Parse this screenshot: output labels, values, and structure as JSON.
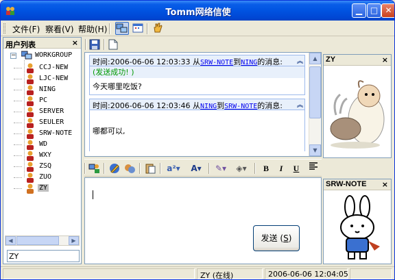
{
  "window": {
    "title": "Tomm网络信使"
  },
  "menu": {
    "items": [
      {
        "label": "文件(F)"
      },
      {
        "label": "察看(V)"
      },
      {
        "label": "帮助(H)"
      }
    ]
  },
  "user_panel": {
    "title": "用户列表",
    "close": "×",
    "root": "WORKGROUP",
    "users": [
      "CCJ-NEW",
      "LJC-NEW",
      "NING",
      "PC",
      "SERVER",
      "SEULER",
      "SRW-NOTE",
      "WD",
      "WXY",
      "ZSQ",
      "ZUO",
      "ZY"
    ],
    "selected_user": "ZY",
    "search_value": "ZY"
  },
  "messages": [
    {
      "time_prefix": "时间:2006-06-06 12:03:33 从",
      "from": "SRW-NOTE",
      "to_word": "到",
      "to": "NING",
      "suffix": "的消息:",
      "status": "(发送成功! )",
      "body": "今天哪里吃饭?"
    },
    {
      "time_prefix": "时间:2006-06-06 12:03:46 从",
      "from": "NING",
      "to_word": "到",
      "to": "SRW-NOTE",
      "suffix": "的消息:",
      "status": "",
      "body": "哪都可以,"
    }
  ],
  "composer": {
    "text": "",
    "send_label_main": "发送 (",
    "send_label_key": "S",
    "send_label_end": ")"
  },
  "avatars": {
    "top_title": "ZY",
    "bottom_title": "SRW-NOTE",
    "close": "×"
  },
  "statusbar": {
    "user_status": "ZY (在线)",
    "datetime": "2006-06-06 12:04:05"
  },
  "colors": {
    "titlebar": "#0053e1",
    "link": "#0000ee",
    "success": "#009900",
    "selection": "#c0c0c0"
  }
}
